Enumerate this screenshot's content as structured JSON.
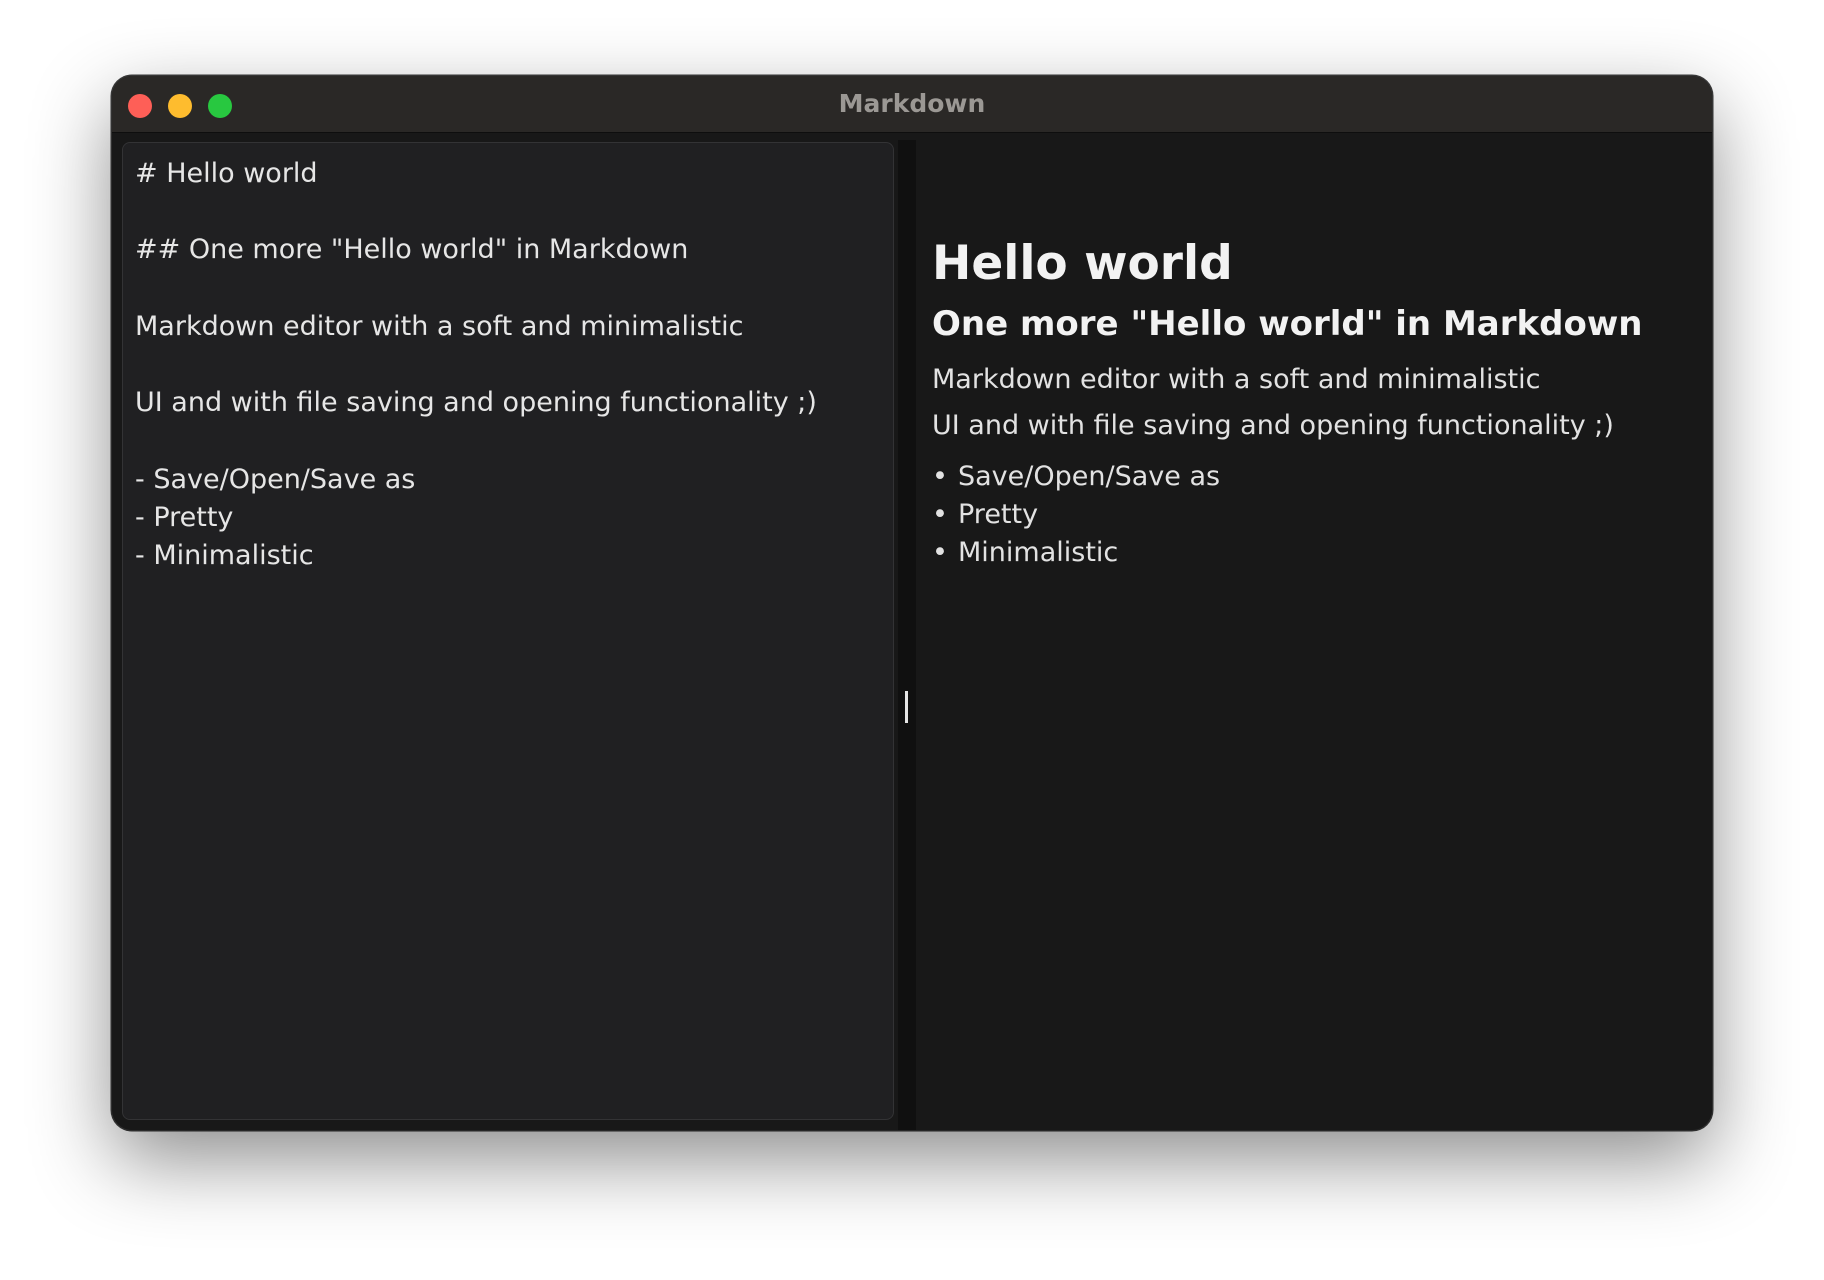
{
  "window": {
    "title": "Markdown"
  },
  "editor": {
    "text": "# Hello world\n\n## One more \"Hello world\" in Markdown\n\nMarkdown editor with a soft and minimalistic\n\nUI and with file saving and opening functionality ;)\n\n- Save/Open/Save as\n- Pretty\n- Minimalistic"
  },
  "preview": {
    "h1": "Hello world",
    "h2": "One more \"Hello world\" in Markdown",
    "paragraphs": [
      "Markdown editor with a soft and minimalistic",
      "UI and with file saving and opening functionality ;)"
    ],
    "bullet_glyph": "•",
    "list_items": [
      "Save/Open/Save as",
      "Pretty",
      "Minimalistic"
    ]
  },
  "colors": {
    "close": "#fe5f57",
    "minimize": "#febc2e",
    "maximize": "#28c840",
    "editor_bg": "#202022",
    "preview_bg": "#181818",
    "titlebar_bg": "#2a2826"
  }
}
